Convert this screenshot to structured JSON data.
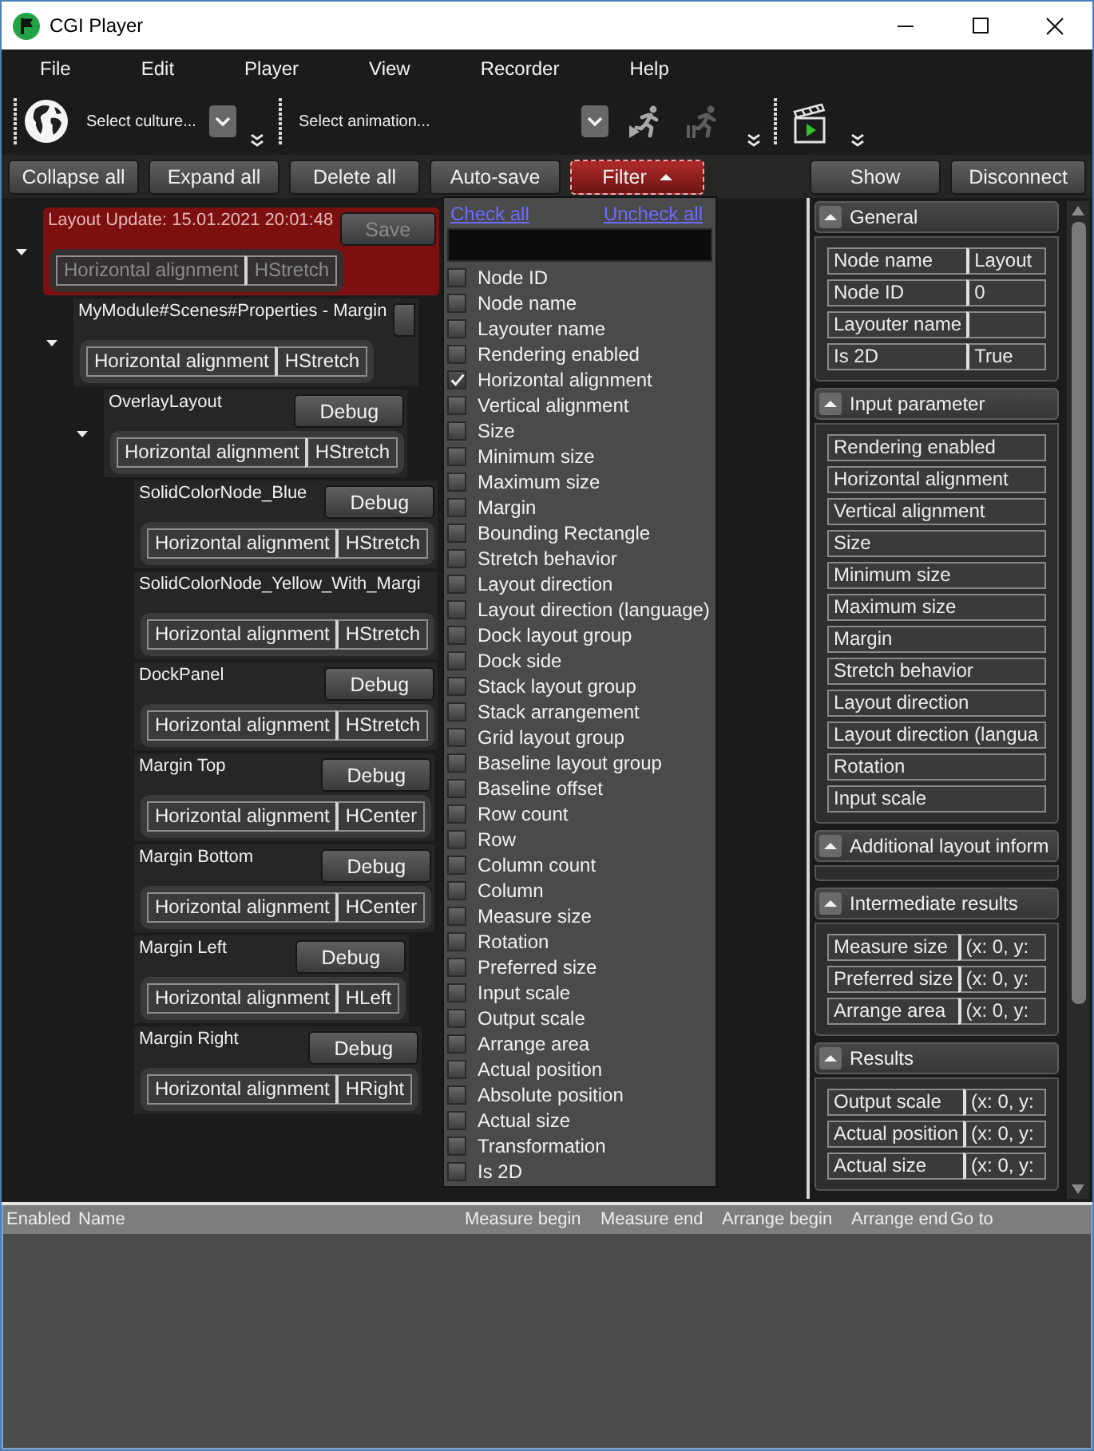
{
  "window": {
    "title": "CGI Player"
  },
  "menu": [
    "File",
    "Edit",
    "Player",
    "View",
    "Recorder",
    "Help"
  ],
  "toolbar": {
    "culture_select": {
      "text": "Select culture..."
    },
    "animation_select": {
      "text": "Select animation..."
    }
  },
  "actions": [
    {
      "label": "Collapse all",
      "kind": "button"
    },
    {
      "label": "Expand all",
      "kind": "button"
    },
    {
      "label": "Delete all",
      "kind": "button"
    },
    {
      "label": "Auto-save",
      "kind": "button"
    },
    {
      "label": "Filter",
      "kind": "dropdown",
      "open": true
    }
  ],
  "connection_actions": [
    "Show",
    "Disconnect"
  ],
  "filter_menu": {
    "check_all": "Check all",
    "uncheck_all": "Uncheck all",
    "items": [
      {
        "label": "Node ID",
        "checked": false
      },
      {
        "label": "Node name",
        "checked": false
      },
      {
        "label": "Layouter name",
        "checked": false
      },
      {
        "label": "Rendering enabled",
        "checked": false
      },
      {
        "label": "Horizontal alignment",
        "checked": true
      },
      {
        "label": "Vertical alignment",
        "checked": false
      },
      {
        "label": "Size",
        "checked": false
      },
      {
        "label": "Minimum size",
        "checked": false
      },
      {
        "label": "Maximum size",
        "checked": false
      },
      {
        "label": "Margin",
        "checked": false
      },
      {
        "label": "Bounding Rectangle",
        "checked": false
      },
      {
        "label": "Stretch behavior",
        "checked": false
      },
      {
        "label": "Layout direction",
        "checked": false
      },
      {
        "label": "Layout direction (language)",
        "checked": false
      },
      {
        "label": "Dock layout group",
        "checked": false
      },
      {
        "label": "Dock side",
        "checked": false
      },
      {
        "label": "Stack layout group",
        "checked": false
      },
      {
        "label": "Stack arrangement",
        "checked": false
      },
      {
        "label": "Grid layout group",
        "checked": false
      },
      {
        "label": "Baseline layout group",
        "checked": false
      },
      {
        "label": "Baseline offset",
        "checked": false
      },
      {
        "label": "Row count",
        "checked": false
      },
      {
        "label": "Row",
        "checked": false
      },
      {
        "label": "Column count",
        "checked": false
      },
      {
        "label": "Column",
        "checked": false
      },
      {
        "label": "Measure size",
        "checked": false
      },
      {
        "label": "Rotation",
        "checked": false
      },
      {
        "label": "Preferred size",
        "checked": false
      },
      {
        "label": "Input scale",
        "checked": false
      },
      {
        "label": "Output scale",
        "checked": false
      },
      {
        "label": "Arrange area",
        "checked": false
      },
      {
        "label": "Actual position",
        "checked": false
      },
      {
        "label": "Absolute position",
        "checked": false
      },
      {
        "label": "Actual size",
        "checked": false
      },
      {
        "label": "Transformation",
        "checked": false
      },
      {
        "label": "Is 2D",
        "checked": false
      }
    ]
  },
  "tree": [
    {
      "title": "Layout Update: 15.01.2021 20:01:48",
      "highlighted": true,
      "disabled": true,
      "expanded": true,
      "button": {
        "label": "Save",
        "clipped": false
      },
      "properties": [
        {
          "name": "Horizontal alignment",
          "value": "HStretch"
        }
      ],
      "children": [
        {
          "title": "MyModule#Scenes#Properties - Margin",
          "highlighted": false,
          "disabled": false,
          "expanded": true,
          "button": {
            "clipped": true
          },
          "properties": [
            {
              "name": "Horizontal alignment",
              "value": "HStretch"
            }
          ],
          "children": [
            {
              "title": "OverlayLayout",
              "highlighted": false,
              "disabled": false,
              "expanded": true,
              "button": {
                "label": "Debug",
                "clipped": false
              },
              "properties": [
                {
                  "name": "Horizontal alignment",
                  "value": "HStretch"
                }
              ],
              "children": [
                {
                  "title": "SolidColorNode_Blue",
                  "highlighted": false,
                  "disabled": false,
                  "button": {
                    "label": "Debug",
                    "clipped": false
                  },
                  "properties": [
                    {
                      "name": "Horizontal alignment",
                      "value": "HStretch"
                    }
                  ]
                },
                {
                  "title": "SolidColorNode_Yellow_With_Margi",
                  "highlighted": false,
                  "disabled": false,
                  "properties": [
                    {
                      "name": "Horizontal alignment",
                      "value": "HStretch"
                    }
                  ]
                },
                {
                  "title": "DockPanel",
                  "highlighted": false,
                  "disabled": false,
                  "button": {
                    "label": "Debug",
                    "clipped": false
                  },
                  "properties": [
                    {
                      "name": "Horizontal alignment",
                      "value": "HStretch"
                    }
                  ]
                },
                {
                  "title": "Margin Top",
                  "highlighted": false,
                  "disabled": false,
                  "button": {
                    "label": "Debug",
                    "clipped": false
                  },
                  "properties": [
                    {
                      "name": "Horizontal alignment",
                      "value": "HCenter"
                    }
                  ]
                },
                {
                  "title": "Margin Bottom",
                  "highlighted": false,
                  "disabled": false,
                  "button": {
                    "label": "Debug",
                    "clipped": false
                  },
                  "properties": [
                    {
                      "name": "Horizontal alignment",
                      "value": "HCenter"
                    }
                  ]
                },
                {
                  "title": "Margin Left",
                  "highlighted": false,
                  "disabled": false,
                  "button": {
                    "label": "Debug",
                    "clipped": false
                  },
                  "properties": [
                    {
                      "name": "Horizontal alignment",
                      "value": "HLeft"
                    }
                  ]
                },
                {
                  "title": "Margin Right",
                  "highlighted": false,
                  "disabled": false,
                  "button": {
                    "label": "Debug",
                    "clipped": false
                  },
                  "properties": [
                    {
                      "name": "Horizontal alignment",
                      "value": "HRight"
                    }
                  ]
                }
              ]
            }
          ]
        }
      ]
    }
  ],
  "details": {
    "sections": [
      {
        "title": "General",
        "expanded": true,
        "rows": [
          {
            "kind": "pair",
            "name": "Node name",
            "value": "Layout"
          },
          {
            "kind": "pair",
            "name": "Node ID",
            "value": "0"
          },
          {
            "kind": "pair",
            "name": "Layouter name"
          },
          {
            "kind": "pair",
            "name": "Is 2D",
            "value": "True"
          }
        ]
      },
      {
        "title": "Input parameter",
        "expanded": true,
        "rows": [
          {
            "kind": "single",
            "name": "Rendering enabled"
          },
          {
            "kind": "single",
            "name": "Horizontal alignment"
          },
          {
            "kind": "single",
            "name": "Vertical alignment"
          },
          {
            "kind": "single",
            "name": "Size"
          },
          {
            "kind": "single",
            "name": "Minimum size"
          },
          {
            "kind": "single",
            "name": "Maximum size"
          },
          {
            "kind": "single",
            "name": "Margin"
          },
          {
            "kind": "single",
            "name": "Stretch behavior"
          },
          {
            "kind": "single",
            "name": "Layout direction"
          },
          {
            "kind": "single",
            "name": "Layout direction (langua"
          },
          {
            "kind": "single",
            "name": "Rotation"
          },
          {
            "kind": "single",
            "name": "Input scale"
          }
        ]
      },
      {
        "title": "Additional layout inform",
        "expanded": true
      },
      {
        "title": "Intermediate results",
        "expanded": true,
        "rows": [
          {
            "kind": "pair",
            "name": "Measure size",
            "value": "(x: 0, y:"
          },
          {
            "kind": "pair",
            "name": "Preferred size",
            "value": "(x: 0, y:"
          },
          {
            "kind": "pair",
            "name": "Arrange area",
            "value": "(x: 0, y:"
          }
        ]
      },
      {
        "title": "Results",
        "expanded": true,
        "rows": [
          {
            "kind": "pair",
            "name": "Output scale",
            "value": "(x: 0, y:"
          },
          {
            "kind": "pair",
            "name": "Actual position",
            "value": "(x: 0, y:"
          },
          {
            "kind": "pair",
            "name": "Actual size",
            "value": "(x: 0, y:"
          }
        ]
      }
    ]
  },
  "event_table": {
    "columns": [
      "Enabled",
      "Name",
      "Measure begin",
      "Measure end",
      "Arrange begin",
      "Arrange end",
      "Go to"
    ]
  }
}
